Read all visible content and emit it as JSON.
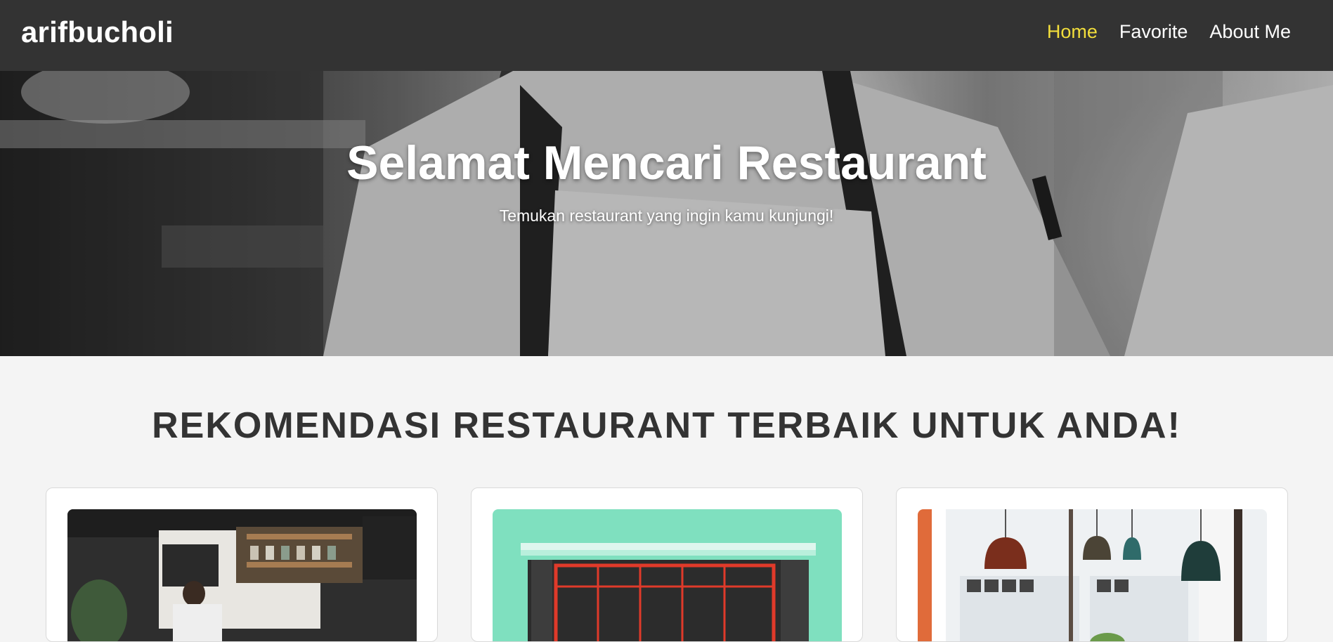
{
  "navbar": {
    "brand": "arifbucholi",
    "links": [
      {
        "label": "Home",
        "active": true
      },
      {
        "label": "Favorite",
        "active": false
      },
      {
        "label": "About Me",
        "active": false
      }
    ]
  },
  "hero": {
    "title": "Selamat Mencari Restaurant",
    "subtitle": "Temukan restaurant yang ingin kamu kunjungi!"
  },
  "section": {
    "title": "REKOMENDASI RESTAURANT TERBAIK UNTUK ANDA!"
  },
  "colors": {
    "navbar_bg": "#333333",
    "active_link": "#f2de3b",
    "page_bg": "#f4f4f4",
    "heading_text": "#333333"
  }
}
